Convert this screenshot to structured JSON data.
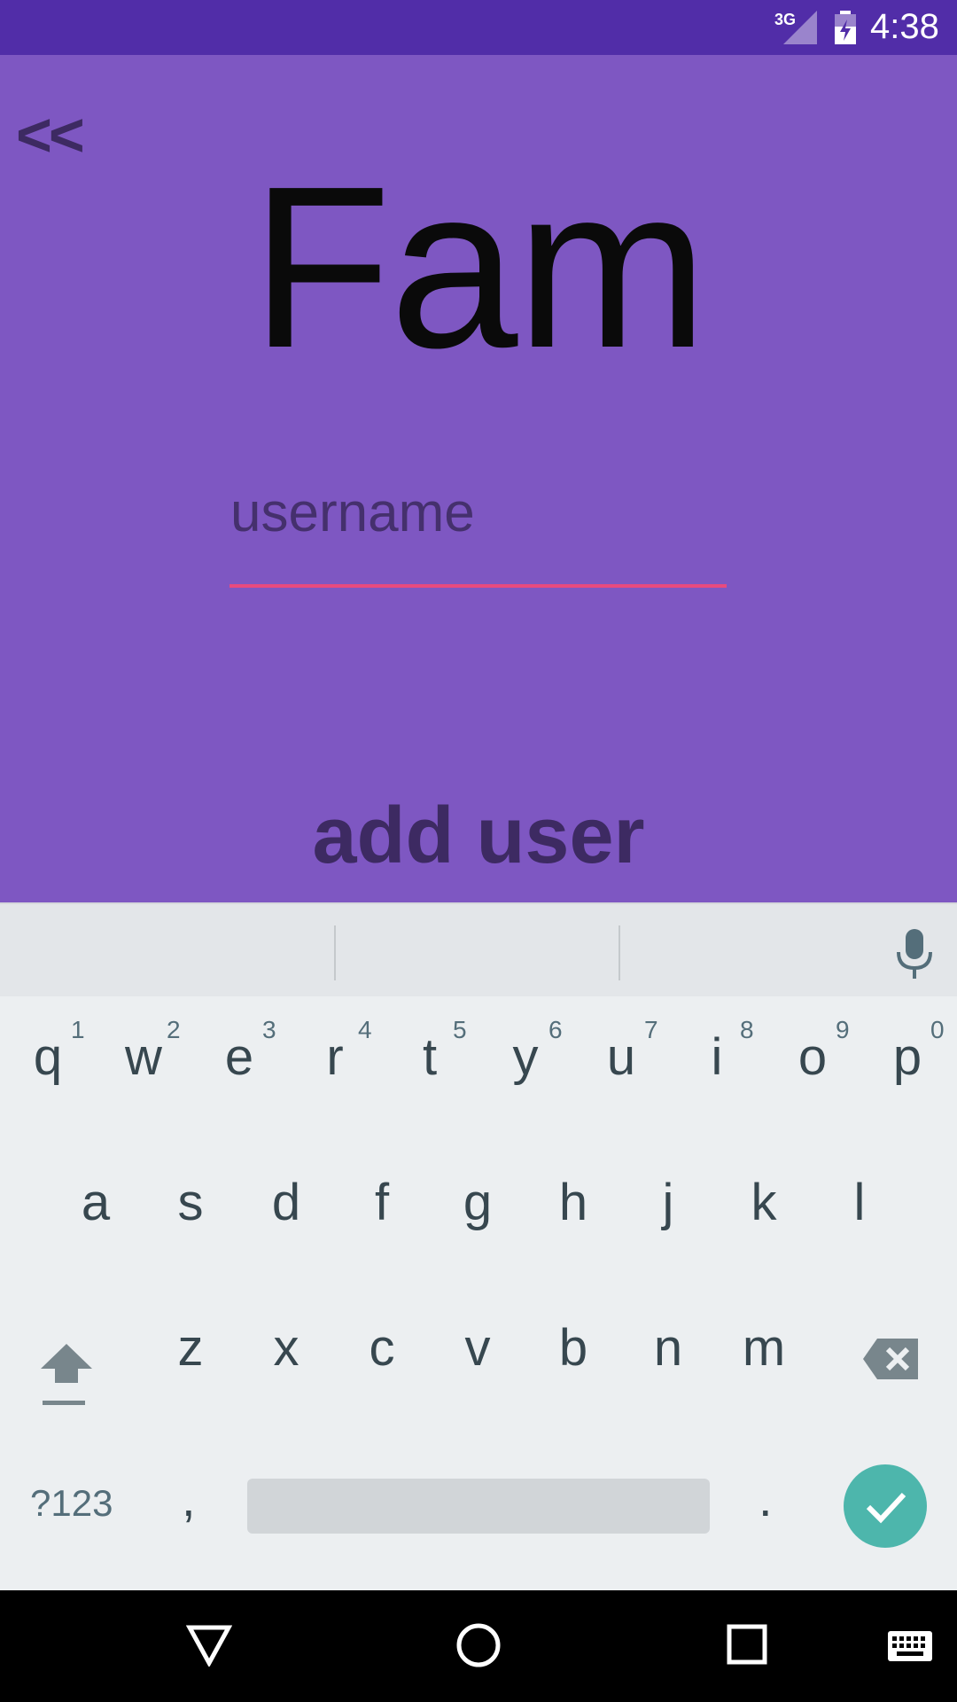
{
  "status_bar": {
    "network": "3G",
    "time": "4:38"
  },
  "app": {
    "back_label": "<<",
    "title": "Fam",
    "username_placeholder": "username",
    "username_value": "",
    "add_user_label": "add user",
    "colors": {
      "background": "#7E57C2",
      "status_bar": "#512DA8",
      "accent": "#E84A7E"
    }
  },
  "keyboard": {
    "row1": [
      {
        "letter": "q",
        "hint": "1"
      },
      {
        "letter": "w",
        "hint": "2"
      },
      {
        "letter": "e",
        "hint": "3"
      },
      {
        "letter": "r",
        "hint": "4"
      },
      {
        "letter": "t",
        "hint": "5"
      },
      {
        "letter": "y",
        "hint": "6"
      },
      {
        "letter": "u",
        "hint": "7"
      },
      {
        "letter": "i",
        "hint": "8"
      },
      {
        "letter": "o",
        "hint": "9"
      },
      {
        "letter": "p",
        "hint": "0"
      }
    ],
    "row2": [
      "a",
      "s",
      "d",
      "f",
      "g",
      "h",
      "j",
      "k",
      "l"
    ],
    "row3": [
      "z",
      "x",
      "c",
      "v",
      "b",
      "n",
      "m"
    ],
    "symbols_label": "?123",
    "comma_label": ",",
    "period_label": ".",
    "icons": [
      "mic-icon",
      "shift-icon",
      "backspace-icon",
      "checkmark-icon"
    ],
    "done_color": "#4DB6AC"
  },
  "nav_bar": {
    "icons": [
      "back-triangle-icon",
      "home-circle-icon",
      "recents-square-icon",
      "keyboard-icon"
    ]
  }
}
